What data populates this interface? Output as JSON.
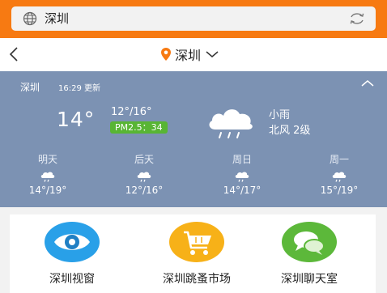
{
  "search": {
    "value": "深圳"
  },
  "nav": {
    "city": "深圳"
  },
  "weather": {
    "city": "深圳",
    "update_time": "16:29 更新",
    "temp": "14°",
    "range": "12°/16°",
    "pm25": "PM2.5：34",
    "description": "小雨",
    "wind": "北风 2级",
    "forecast": [
      {
        "day": "明天",
        "temp": "14°/19°"
      },
      {
        "day": "后天",
        "temp": "12°/16°"
      },
      {
        "day": "周日",
        "temp": "14°/17°"
      },
      {
        "day": "周一",
        "temp": "15°/19°"
      }
    ]
  },
  "apps": [
    {
      "label": "深圳视窗",
      "icon": "eye-icon",
      "color": "#29a0e8"
    },
    {
      "label": "深圳跳蚤市场",
      "icon": "shopping-cart-icon",
      "color": "#f7b118"
    },
    {
      "label": "深圳聊天室",
      "icon": "chat-bubbles-icon",
      "color": "#5cb83a"
    }
  ],
  "colors": {
    "header": "#f77a12",
    "weather_bg": "#7c92b3",
    "pm_badge": "#58b534"
  }
}
